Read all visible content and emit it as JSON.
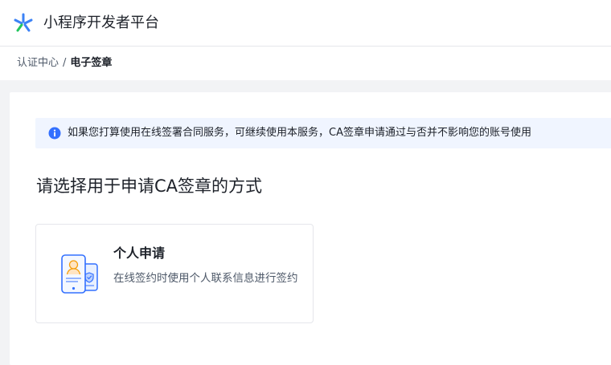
{
  "header": {
    "app_title": "小程序开发者平台",
    "logo_icon": "miniprogram-logo-icon",
    "logo_colors": [
      "#3b82f6",
      "#22c55e"
    ]
  },
  "breadcrumb": {
    "parent": "认证中心",
    "separator": "/",
    "current": "电子签章"
  },
  "notice": {
    "icon": "info-icon",
    "text": "如果您打算使用在线签署合同服务，可继续使用本服务，CA签章申请通过与否并不影响您的账号使用",
    "icon_color": "#3370ff"
  },
  "main": {
    "section_title": "请选择用于申请CA签章的方式",
    "options": [
      {
        "icon": "personal-id-phone-icon",
        "title": "个人申请",
        "description": "在线签约时使用个人联系信息进行签约"
      }
    ]
  }
}
